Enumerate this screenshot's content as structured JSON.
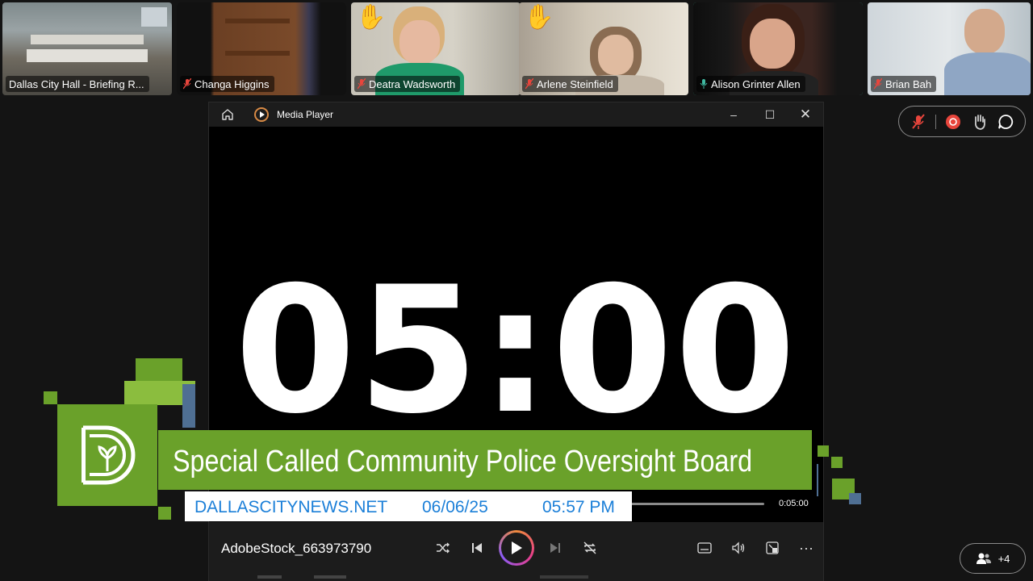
{
  "participants": [
    {
      "name": "Dallas City Hall - Briefing R...",
      "hand_raised": false,
      "speaking": false,
      "mic_muted": false
    },
    {
      "name": "Changa Higgins",
      "hand_raised": false,
      "speaking": false,
      "mic_muted": true
    },
    {
      "name": "Deatra Wadsworth",
      "hand_raised": true,
      "speaking": false,
      "mic_muted": true
    },
    {
      "name": "Arlene Steinfield",
      "hand_raised": true,
      "speaking": false,
      "mic_muted": true
    },
    {
      "name": "Alison Grinter Allen",
      "hand_raised": false,
      "speaking": true,
      "mic_muted": false
    },
    {
      "name": "Brian Bah",
      "hand_raised": false,
      "speaking": false,
      "mic_muted": true
    }
  ],
  "controls": {
    "icons": [
      "mic-muted-icon",
      "record-icon",
      "raise-hand-icon",
      "chat-icon"
    ],
    "people_count": "+4"
  },
  "media_player": {
    "title": "Media Player",
    "timer": "05:00",
    "duration": "0:05:00",
    "filename": "AdobeStock_663973790"
  },
  "broadcast": {
    "headline": "Special Called Community Police Oversight Board",
    "site": "DALLASCITYNEWS.NET",
    "date": "06/06/25",
    "time": "05:57 PM"
  },
  "colors": {
    "brand_green": "#6aa12a",
    "info_blue": "#1b7fd8",
    "speaking_outline": "#3fb8a0",
    "hand_yellow": "#f2b233",
    "record_red": "#e8453c"
  }
}
